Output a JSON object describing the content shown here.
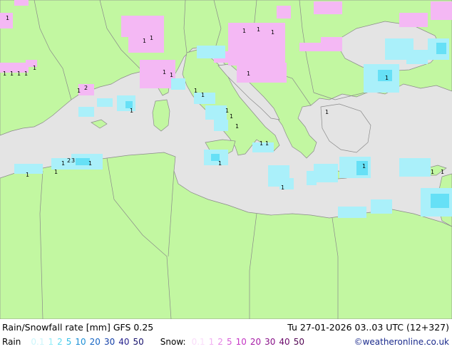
{
  "footer": {
    "title": "Rain/Snowfall rate [mm] GFS 0.25",
    "timestamp": "Tu 27-01-2026 03..03 UTC (12+327)",
    "credit": "©weatheronline.co.uk",
    "rain_label": "Rain",
    "snow_label": "Snow:",
    "rain_scale": [
      {
        "label": "0.1",
        "color": "#ccf6fb"
      },
      {
        "label": "1",
        "color": "#96eef8"
      },
      {
        "label": "2",
        "color": "#5fdcf2"
      },
      {
        "label": "5",
        "color": "#33bde6"
      },
      {
        "label": "10",
        "color": "#1b8fd6"
      },
      {
        "label": "20",
        "color": "#1565c4"
      },
      {
        "label": "30",
        "color": "#1540a8"
      },
      {
        "label": "40",
        "color": "#241f8c"
      },
      {
        "label": "50",
        "color": "#140f6a"
      }
    ],
    "snow_scale": [
      {
        "label": "0.1",
        "color": "#fadcfa"
      },
      {
        "label": "1",
        "color": "#f3b3f3"
      },
      {
        "label": "2",
        "color": "#e889e8"
      },
      {
        "label": "5",
        "color": "#d659d6"
      },
      {
        "label": "10",
        "color": "#c434c4"
      },
      {
        "label": "20",
        "color": "#a61aa6"
      },
      {
        "label": "30",
        "color": "#871087"
      },
      {
        "label": "40",
        "color": "#6a086a"
      },
      {
        "label": "50",
        "color": "#520552"
      }
    ]
  },
  "map_colors": {
    "sea": "#e4e4e4",
    "land": "#c2f7a1",
    "border": "#8a8a8a",
    "rain_light": "#aaf0fa",
    "rain_medium": "#66e0f6",
    "snow_light": "#f4b8f4"
  },
  "rate_labels": [
    "1",
    "1",
    "1",
    "1",
    "1",
    "1",
    "1",
    "2",
    "3",
    "1",
    "2",
    "1",
    "1",
    "1",
    "1",
    "1",
    "1",
    "1",
    "1",
    "1",
    "1",
    "1",
    "1",
    "1",
    "1",
    "1",
    "1",
    "1",
    "1",
    "1",
    "1",
    "1",
    "1",
    "1",
    "1",
    "1",
    "1"
  ]
}
